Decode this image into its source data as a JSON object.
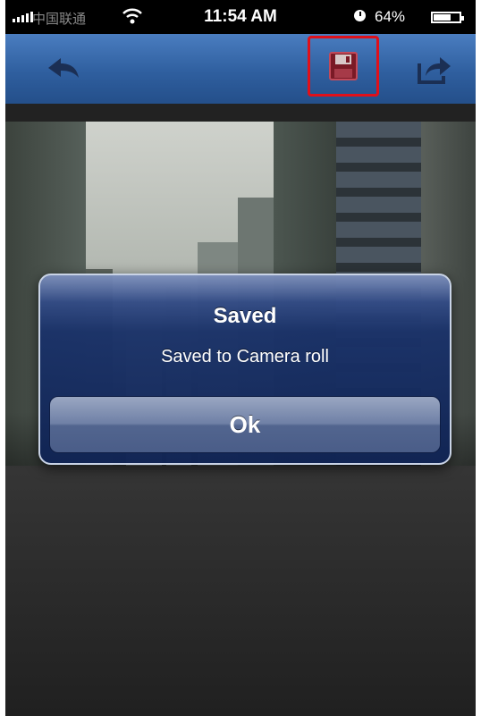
{
  "status_bar": {
    "carrier": "中国联通",
    "time": "11:54 AM",
    "battery_percent": "64%"
  },
  "toolbar": {
    "back_icon": "back-arrow-icon",
    "save_icon": "floppy-disk-icon",
    "share_icon": "share-icon",
    "highlight_color": "#e0101a"
  },
  "dialog": {
    "title": "Saved",
    "message": "Saved to Camera roll",
    "ok_label": "Ok"
  }
}
